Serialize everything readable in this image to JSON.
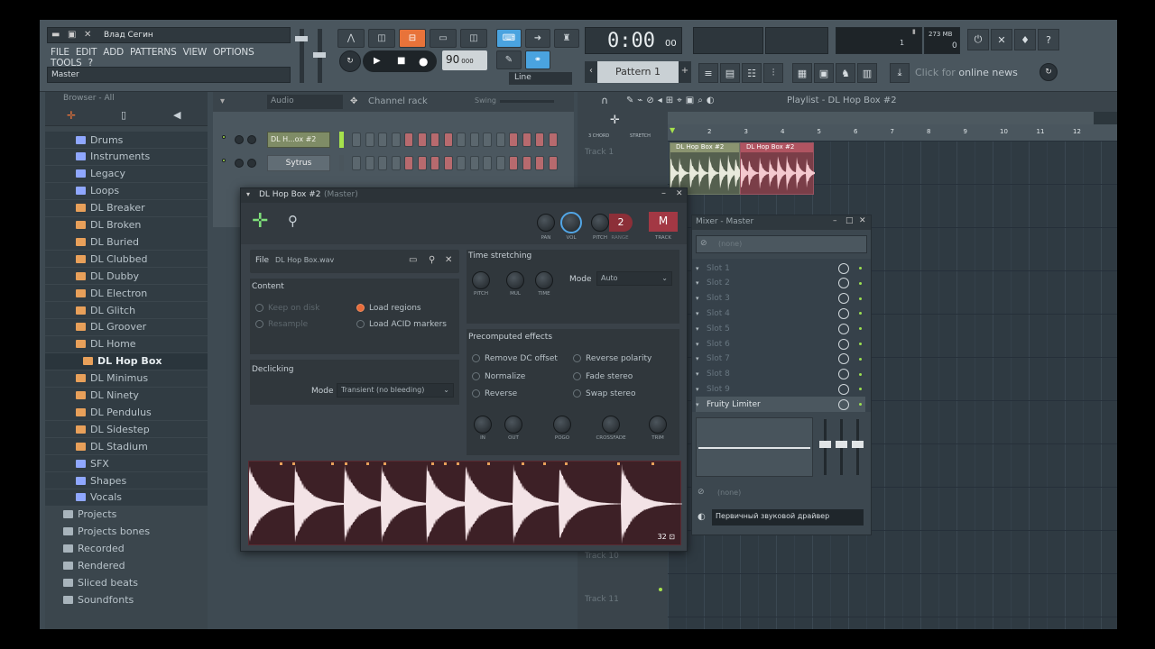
{
  "title": {
    "user": "Влад Сегин",
    "window_label": "Master"
  },
  "menu": [
    "FILE",
    "EDIT",
    "ADD",
    "PATTERNS",
    "VIEW",
    "OPTIONS",
    "TOOLS",
    "?"
  ],
  "transport": {
    "tempo": "90",
    "tempo_dec": "000",
    "time": "0:00",
    "time_sub": "00",
    "line_mode": "Line",
    "pattern": "Pattern 1",
    "memory": "273 MB",
    "cpu": "0",
    "voices": "1"
  },
  "news": {
    "prefix": "Click for ",
    "main": "online news"
  },
  "browser": {
    "title": "Browser - All",
    "items": [
      {
        "label": "Drums",
        "kind": "folder"
      },
      {
        "label": "Instruments",
        "kind": "folder"
      },
      {
        "label": "Legacy",
        "kind": "folder"
      },
      {
        "label": "Loops",
        "kind": "folder"
      },
      {
        "label": "DL Breaker",
        "kind": "pack"
      },
      {
        "label": "DL Broken",
        "kind": "pack"
      },
      {
        "label": "DL Buried",
        "kind": "pack"
      },
      {
        "label": "DL Clubbed",
        "kind": "pack"
      },
      {
        "label": "DL Dubby",
        "kind": "pack"
      },
      {
        "label": "DL Electron",
        "kind": "pack"
      },
      {
        "label": "DL Glitch",
        "kind": "pack"
      },
      {
        "label": "DL Groover",
        "kind": "pack"
      },
      {
        "label": "DL Home",
        "kind": "pack"
      },
      {
        "label": "DL Hop Box",
        "kind": "pack"
      },
      {
        "label": "DL Minimus",
        "kind": "pack"
      },
      {
        "label": "DL Ninety",
        "kind": "pack"
      },
      {
        "label": "DL Pendulus",
        "kind": "pack"
      },
      {
        "label": "DL Sidestep",
        "kind": "pack"
      },
      {
        "label": "DL Stadium",
        "kind": "pack"
      },
      {
        "label": "SFX",
        "kind": "folder"
      },
      {
        "label": "Shapes",
        "kind": "folder"
      },
      {
        "label": "Vocals",
        "kind": "folder"
      },
      {
        "label": "Projects",
        "kind": "other"
      },
      {
        "label": "Projects bones",
        "kind": "other"
      },
      {
        "label": "Recorded",
        "kind": "other"
      },
      {
        "label": "Rendered",
        "kind": "other"
      },
      {
        "label": "Sliced beats",
        "kind": "other"
      },
      {
        "label": "Soundfonts",
        "kind": "other"
      }
    ]
  },
  "channel_rack": {
    "title": "Channel rack",
    "filter": "Audio",
    "swing": "Swing",
    "channels": [
      "DL H...ox #2",
      "Sytrus"
    ]
  },
  "playlist": {
    "title": "Playlist - DL Hop Box #2",
    "ruler": [
      "2",
      "3",
      "4",
      "5",
      "6",
      "7",
      "8",
      "9",
      "10",
      "11",
      "12"
    ],
    "clip1": "DL Hop Box #2",
    "clip2": "DL Hop Box #2",
    "track_top": "Track 1",
    "track_a": "Track 10",
    "track_b": "Track 11",
    "top_labels": [
      "3 CHORD",
      "STRETCH"
    ]
  },
  "sampler": {
    "title": "DL Hop Box #2",
    "title_suffix": "(Master)",
    "knobs_top": [
      "PAN",
      "VOL",
      "PITCH"
    ],
    "pitch_value": "2",
    "range_label": "RANGE",
    "track_label": "TRACK",
    "track_letter": "M",
    "file_label": "File",
    "file_name": "DL Hop Box.wav",
    "content_label": "Content",
    "content_opts": [
      "Keep on disk",
      "Resample",
      "Load regions",
      "Load ACID markers"
    ],
    "declicking_label": "Declicking",
    "declick_mode_label": "Mode",
    "declick_mode": "Transient (no bleeding)",
    "time_stretch_label": "Time stretching",
    "ts_knobs": [
      "PITCH",
      "MUL",
      "TIME"
    ],
    "ts_mode_label": "Mode",
    "ts_mode": "Auto",
    "precomputed_label": "Precomputed effects",
    "effects": [
      "Remove DC offset",
      "Normalize",
      "Reverse",
      "Reverse polarity",
      "Fade stereo",
      "Swap stereo"
    ],
    "effect_knobs": [
      "IN",
      "OUT",
      "POGO",
      "CROSSFADE",
      "TRIM"
    ],
    "wave_counter": "32"
  },
  "mixer": {
    "title": "Mixer - Master",
    "input": "(none)",
    "slots": [
      "Slot 1",
      "Slot 2",
      "Slot 3",
      "Slot 4",
      "Slot 5",
      "Slot 6",
      "Slot 7",
      "Slot 8",
      "Slot 9"
    ],
    "plugin": "Fruity Limiter",
    "output_none": "(none)",
    "driver": "Первичный звуковой драйвер"
  }
}
